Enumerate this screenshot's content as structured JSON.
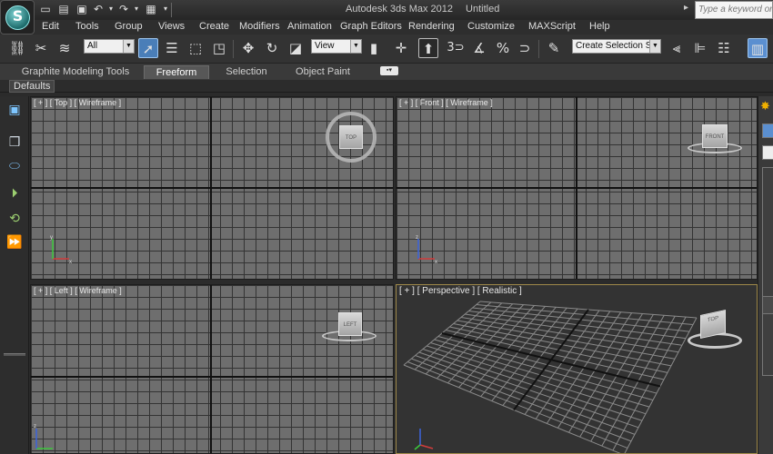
{
  "window": {
    "title": "Autodesk 3ds Max 2012",
    "document": "Untitled",
    "search_placeholder": "Type a keyword or p"
  },
  "quick_access": [
    "new",
    "open",
    "save",
    "undo",
    "redo",
    "project-folder"
  ],
  "menu": [
    "Edit",
    "Tools",
    "Group",
    "Views",
    "Create",
    "Modifiers",
    "Animation",
    "Graph Editors",
    "Rendering",
    "Customize",
    "MAXScript",
    "Help"
  ],
  "toolbar": {
    "filter_select": "All",
    "ref_coord_select": "View",
    "snap_label": "3",
    "named_selection_placeholder": "Create Selection Se"
  },
  "ribbon": {
    "tabs": [
      {
        "label": "Graphite Modeling Tools",
        "active": false
      },
      {
        "label": "Freeform",
        "active": true
      },
      {
        "label": "Selection",
        "active": false
      },
      {
        "label": "Object Paint",
        "active": false
      }
    ],
    "defaults_label": "Defaults"
  },
  "viewports": {
    "top": {
      "label": "[ + ] [ Top ] [ Wireframe ]",
      "cube_face": "TOP"
    },
    "front": {
      "label": "[ + ] [ Front ] [ Wireframe ]",
      "cube_face": "FRONT"
    },
    "left": {
      "label": "[ + ] [ Left ] [ Wireframe ]",
      "cube_face": "LEFT"
    },
    "perspective": {
      "label": "[ + ] [ Perspective ] [ Realistic ]",
      "cube_face": "TOP"
    }
  },
  "colors": {
    "accent_blue": "#4a7eb8",
    "viewport_grid": "#6e6e6e",
    "perspective_border": "#a08a4a",
    "axis_x": "#d23c3c",
    "axis_y": "#3cc83c",
    "axis_z": "#3c64dc"
  }
}
